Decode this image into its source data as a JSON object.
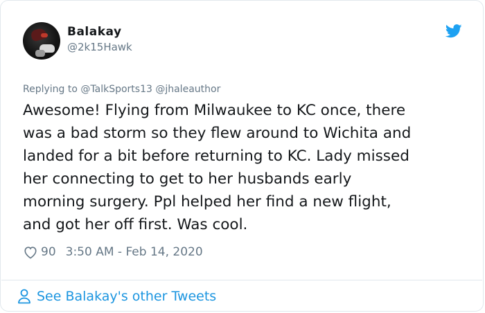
{
  "tweet": {
    "display_name": "Balakay",
    "handle": "@2k15Hawk",
    "reply_prefix": "Replying to",
    "reply_mentions": "@TalkSports13 @jhaleauthor",
    "text": "Awesome! Flying from Milwaukee to KC once, there\nwas a bad storm so they flew around to Wichita and\nlanded for a bit before returning to KC. Lady missed\nher connecting to get to her husbands early\nmorning surgery. Ppl helped her find a new flight,\nand got her off first. Was cool.",
    "likes": "90",
    "timestamp": "3:50 AM - Feb 14, 2020"
  },
  "footer": {
    "label": "See Balakay's other Tweets"
  },
  "icons": {
    "brand": "twitter-bird-icon",
    "like": "heart-icon",
    "profile": "person-icon"
  },
  "colors": {
    "accent": "#1da1f2",
    "link": "#1b95e0",
    "secondary_text": "#657786",
    "border": "#e1e8ed"
  }
}
